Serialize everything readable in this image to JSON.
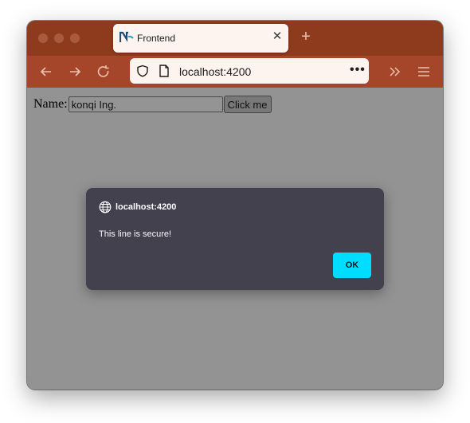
{
  "browser": {
    "tab_title": "Frontend",
    "url": "localhost:4200",
    "colors": {
      "tabbar": "#8e3a1c",
      "toolbar": "#a5462a",
      "urlbar": "#fdf3ef"
    }
  },
  "page": {
    "name_label": "Name:",
    "name_value": "konqi Ing.",
    "button_label": "Click me"
  },
  "dialog": {
    "origin": "localhost:4200",
    "message": "This line is secure!",
    "ok_label": "OK",
    "colors": {
      "background": "#42414d",
      "ok_button": "#00ddff"
    }
  }
}
